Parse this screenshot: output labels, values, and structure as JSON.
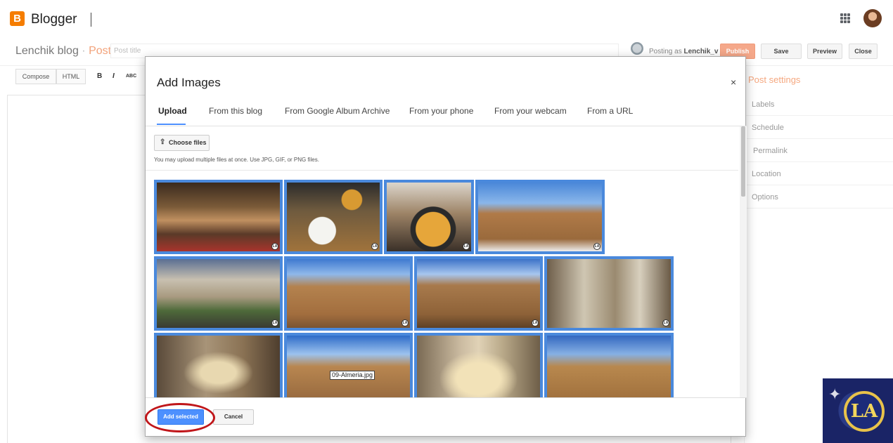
{
  "app": {
    "brand": "Blogger",
    "logo_letter": "B"
  },
  "post_header": {
    "blog_name": "Lenchik blog",
    "separator": "·",
    "post_label": "Post",
    "title_placeholder": "Post title",
    "posting_as_prefix": "Posting as",
    "posting_as_user": "Lenchik_v",
    "buttons": {
      "publish": "Publish",
      "save": "Save",
      "preview": "Preview",
      "close": "Close"
    }
  },
  "editor_toolbar": {
    "modes": [
      "Compose",
      "HTML"
    ],
    "format_glyphs": [
      "B",
      "I",
      "ABC"
    ]
  },
  "side_panel": {
    "title": "Post settings",
    "items": [
      "Labels",
      "Schedule",
      "Permalink",
      "Location",
      "Options"
    ]
  },
  "watermark": {
    "text": "LA"
  },
  "dialog": {
    "title": "Add Images",
    "close_glyph": "×",
    "tabs": [
      "Upload",
      "From this blog",
      "From Google Album Archive",
      "From your phone",
      "From your webcam",
      "From a URL"
    ],
    "active_tab": "Upload",
    "choose_files_label": "Choose files",
    "upload_icon_glyph": "⇪",
    "upload_note": "You may upload multiple files at once. Use JPG, GIF, or PNG files.",
    "tooltip": "09-Almeria.jpg",
    "image_badge": "LA",
    "add_selected_label": "Add selected",
    "cancel_label": "Cancel"
  },
  "colors": {
    "accent_blue": "#4a89dc",
    "brand_orange": "#f57d00",
    "annotation_red": "#c0161a"
  }
}
